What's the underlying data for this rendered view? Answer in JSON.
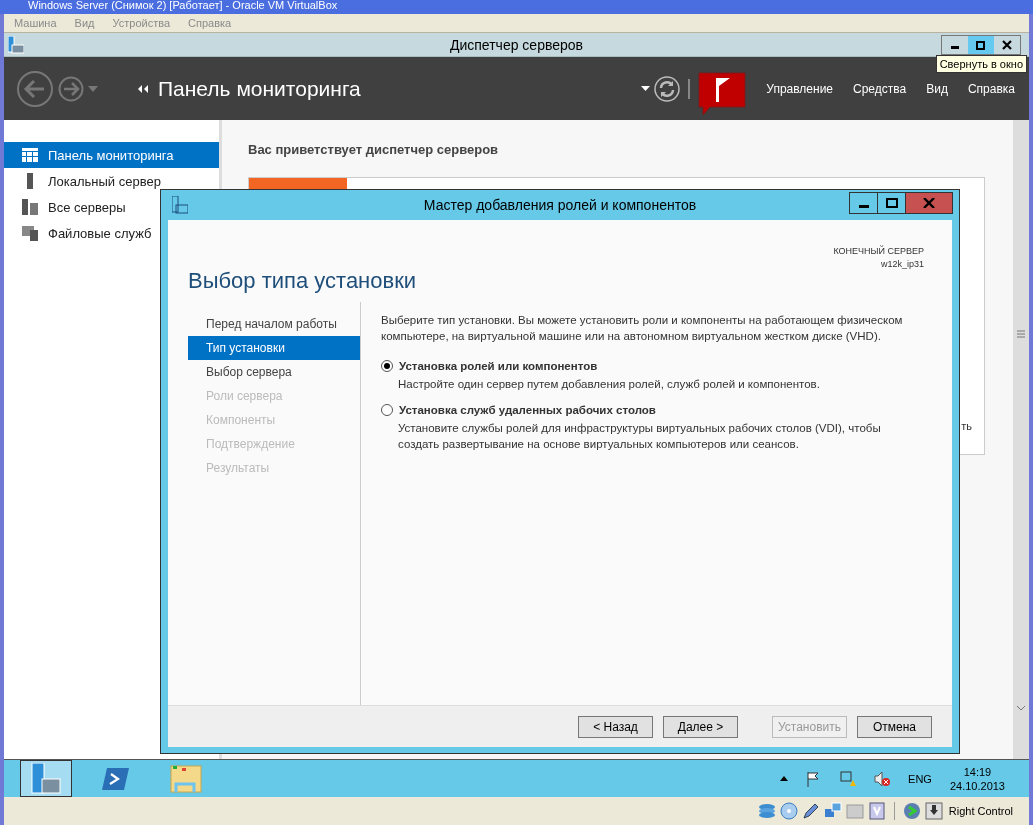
{
  "vbox": {
    "title": "Windows Server (Снимок 2) [Работает] - Oracle VM VirtualBox",
    "menu": [
      "Машина",
      "Вид",
      "Устройства",
      "Справка"
    ],
    "host_key": "Right Control"
  },
  "server_manager": {
    "title": "Диспетчер серверов",
    "tooltip": "Свернуть в окно",
    "header_title": "Панель мониторинга",
    "header_menu": [
      "Управление",
      "Средства",
      "Вид",
      "Справка"
    ],
    "sidebar": [
      {
        "kind": "dashboard",
        "label": "Панель мониторинга",
        "selected": true
      },
      {
        "kind": "server",
        "label": "Локальный сервер",
        "selected": false
      },
      {
        "kind": "servers",
        "label": "Все серверы",
        "selected": false
      },
      {
        "kind": "files",
        "label": "Файловые служб",
        "selected": false
      }
    ],
    "welcome": "Вас приветствует диспетчер серверов",
    "card_fragment": "ть"
  },
  "wizard": {
    "title": "Мастер добавления ролей и компонентов",
    "heading": "Выбор типа установки",
    "target_label": "КОНЕЧНЫЙ СЕРВЕР",
    "target_name": "w12k_ip31",
    "steps": [
      {
        "label": "Перед началом работы",
        "selected": false,
        "disabled": false
      },
      {
        "label": "Тип установки",
        "selected": true,
        "disabled": false
      },
      {
        "label": "Выбор сервера",
        "selected": false,
        "disabled": false
      },
      {
        "label": "Роли сервера",
        "selected": false,
        "disabled": true
      },
      {
        "label": "Компоненты",
        "selected": false,
        "disabled": true
      },
      {
        "label": "Подтверждение",
        "selected": false,
        "disabled": true
      },
      {
        "label": "Результаты",
        "selected": false,
        "disabled": true
      }
    ],
    "intro": "Выберите тип установки. Вы можете установить роли и компоненты на работающем физическом компьютере, на виртуальной машине или на автономном виртуальном жестком диске (VHD).",
    "options": [
      {
        "title": "Установка ролей или компонентов",
        "description": "Настройте один сервер путем добавления ролей, служб ролей и компонентов.",
        "selected": true
      },
      {
        "title": "Установка служб удаленных рабочих столов",
        "description": "Установите службы ролей для инфраструктуры виртуальных рабочих столов (VDI), чтобы создать развертывание на основе виртуальных компьютеров или сеансов.",
        "selected": false
      }
    ],
    "buttons": [
      {
        "label": "< Назад",
        "disabled": false
      },
      {
        "label": "Далее >",
        "disabled": false
      },
      {
        "label": "Установить",
        "disabled": true
      },
      {
        "label": "Отмена",
        "disabled": false
      }
    ]
  },
  "taskbar": {
    "language": "ENG",
    "time": "14:19",
    "date": "24.10.2013"
  }
}
